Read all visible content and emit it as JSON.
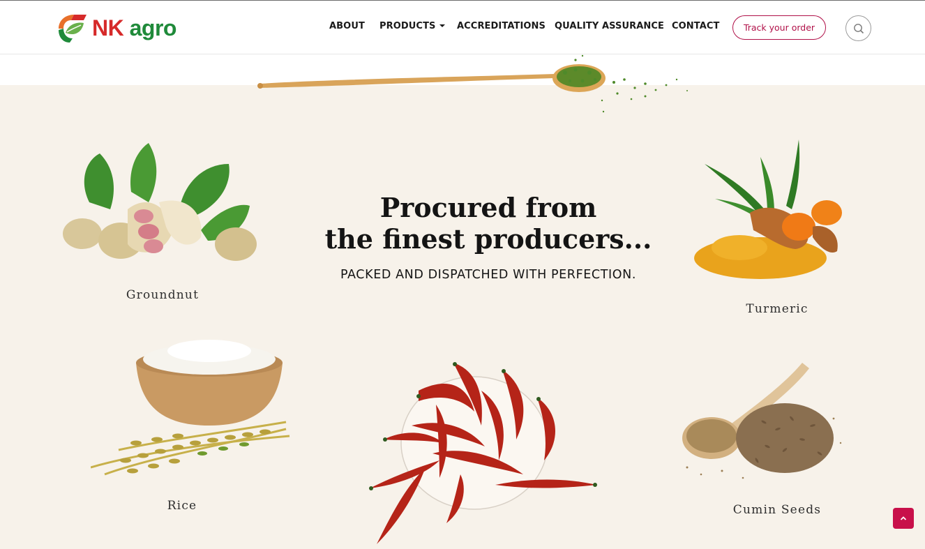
{
  "brand": {
    "nk": "NK",
    "agro": "agro"
  },
  "nav": {
    "about": "ABOUT",
    "products": "PRODUCTS",
    "accreditations": "ACCREDITATIONS",
    "quality_assurance": "QUALITY ASSURANCE",
    "contact": "CONTACT",
    "track_order": "Track your order"
  },
  "hero": {
    "headline_line1": "Procured from",
    "headline_line2": "the finest producers...",
    "subline": "PACKED AND DISPATCHED WITH PERFECTION."
  },
  "products": [
    {
      "label": "Groundnut",
      "icon": "groundnut-image"
    },
    {
      "label": "Turmeric",
      "icon": "turmeric-image"
    },
    {
      "label": "Rice",
      "icon": "rice-image"
    },
    {
      "label": "Cumin Seeds",
      "icon": "cumin-seeds-image"
    },
    {
      "label": "",
      "icon": "red-chilli-image"
    }
  ],
  "colors": {
    "accent": "#b01048",
    "back_to_top": "#c8104a",
    "background": "#f7f2ea",
    "logo_red": "#d62a2a",
    "logo_green": "#1f8a3a"
  }
}
